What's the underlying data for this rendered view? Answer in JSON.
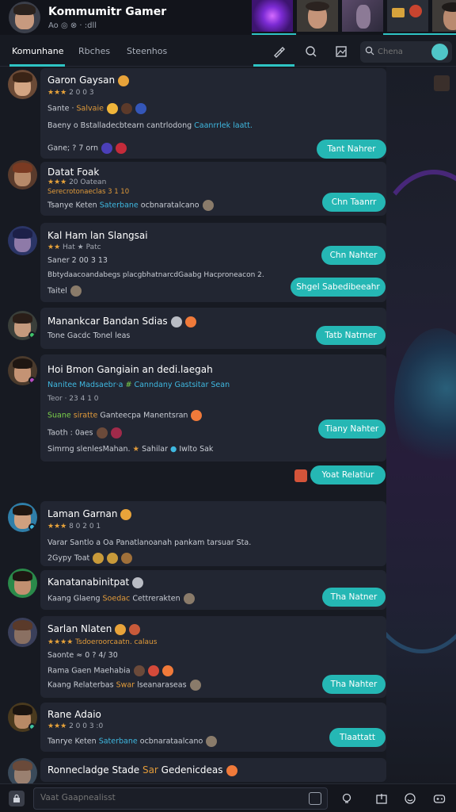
{
  "header": {
    "title": "Kommumitr Gamer",
    "subtitle": "Ao ◎ ⊗ · :dll",
    "thumbnails": [
      "purple-energy",
      "hero-portrait",
      "armored-warrior",
      "gadget-items",
      "man-portrait"
    ]
  },
  "tabs": [
    {
      "label": "Komunhane",
      "active": true
    },
    {
      "label": "Rbches",
      "active": false
    },
    {
      "label": "Steenhos",
      "active": false
    }
  ],
  "toolbar": {
    "icons": [
      "brush-icon",
      "search-icon",
      "image-icon"
    ]
  },
  "search": {
    "placeholder": "Chena"
  },
  "posts": [
    {
      "name": "Garon Gaysan",
      "stars": "★★★ ",
      "rating_text": "2 0 0 3",
      "line1_a": "Sante · ",
      "line1_b": "Salvaie",
      "line2_a": "Baeny o Bstalladecbtearn cantrlodong ",
      "line2_b": "Caanrrlek  laatt.",
      "line3": "Gane; ? 7 orn",
      "action": "Tant Nahrer"
    },
    {
      "name": "Datat Foak",
      "stars": "★★★ ",
      "rating_text": "20 Oatean",
      "line1_a": "Serecrotonaeclas ",
      "line1_b": "3 1 10",
      "line2_a": "Tsanye Keten ",
      "line2_b": "Saterbane",
      "line2_c": " ocbnaratalcano",
      "action": "Chn Taanrr"
    },
    {
      "name": "Kal Ham lan Slangsai",
      "stars": "★★ ",
      "rating_text": "Hat ★ Patc",
      "line1_a": "Saner 2 00 3 13",
      "line2_a": "Bbtydaacoandabegs placgbhatnarcdGaabg Hacproneacon 2.",
      "line3": "Taitel",
      "action": "Chn Nahter",
      "action2": "Shgel Sabedibeeahr"
    },
    {
      "name": "Manankcar Bandan Sdias",
      "line1_a": "Tone Gacdc Tonel leas",
      "action": "Tatb Natrner"
    },
    {
      "name": "Hoi Bmon Gangiain  an dedi.laegah",
      "line1_a": "Nanitee Madsaebr·a ",
      "line1_b": "# ",
      "line1_c": "Canndany Gastsitar Sean",
      "stars": "",
      "rating_text": "Teor · 23 4 1 0",
      "line2_a": "Suane ",
      "line2_b": "siratte ",
      "line2_c": "Ganteecpa Manentsran",
      "line3": "Taoth : 0aes",
      "line4_a": "Simrng slenlesMahan. ",
      "line4_b": "★ ",
      "line4_c": "Sahilar ",
      "line4_d": "● ",
      "line4_e": "Iwlto Sak",
      "action": "Tiany Nahter"
    },
    {
      "action": "Yoat Relatiur"
    },
    {
      "name": "Laman Garnan",
      "stars": "★★★ ",
      "rating_text": "8 0 2 0 1",
      "line1_a": "Varar Santlo a Oa Panatlanoanah pankam tarsuar Sta.",
      "line2_a": "2Gypy Toat",
      "action": ""
    },
    {
      "name": "Kanatanabinitpat",
      "line1_a": "Kaang Glaeng ",
      "line1_b": "Soedac ",
      "line1_c": "Cettrerakten",
      "action": "Tha Natner"
    },
    {
      "name": "Sarlan Nlaten",
      "stars": "★★★★ ",
      "rating_text": "Tsdoeroorcaatn. calaus",
      "line1_a": "Saonte ≈ 0 ? 4/ 30",
      "line2_a": "Rama Gaen Maehabia",
      "line3_a": "Kaang Relaterbas ",
      "line3_b": "Swar ",
      "line3_c": "lseanaraseas",
      "action": "Tha Nahter"
    },
    {
      "name": "Rane Adaio",
      "stars": "★★★ ",
      "rating_text": "2 0 0 3 :0",
      "line1_a": "Tanrye Keten ",
      "line1_b": "Saterbane",
      "line1_c": " ocbnarataalcano",
      "action": "Tlaattatt"
    },
    {
      "name": "Ronnecladge Stade ",
      "name_b": "Sar ",
      "name_c": "Gedenicdeas"
    }
  ],
  "composer": {
    "placeholder": "Vaat Gaapnealisst"
  },
  "bottom_icons": [
    "lock-icon",
    "idea-icon",
    "share-icon",
    "emoji-icon",
    "controller-icon"
  ],
  "colors": {
    "accent": "#25b7b4",
    "card": "#222632",
    "background": "#171a22",
    "star": "#e8a33a"
  }
}
